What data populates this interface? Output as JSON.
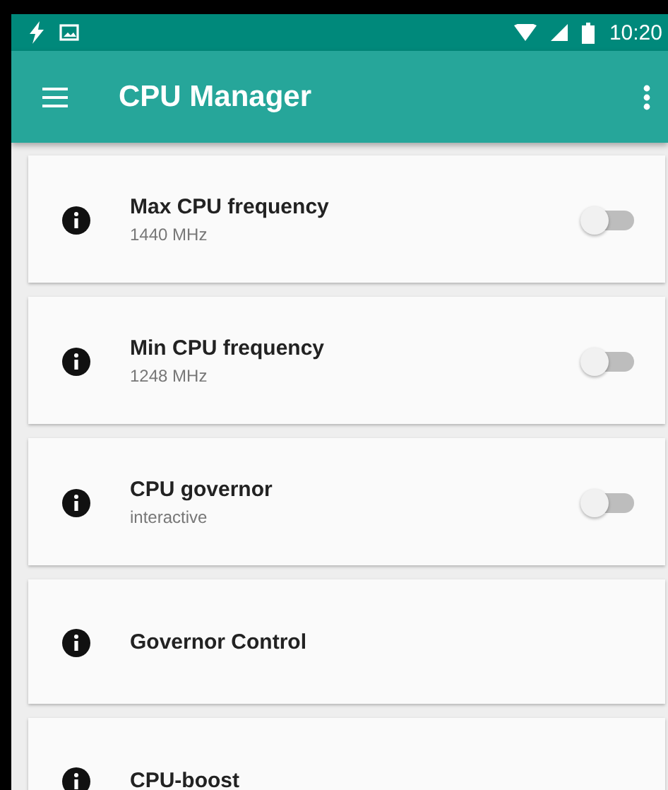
{
  "status_bar": {
    "time": "10:20"
  },
  "app_bar": {
    "title": "CPU Manager"
  },
  "items": [
    {
      "title": "Max CPU frequency",
      "subtitle": "1440 MHz",
      "toggle": {
        "on": false
      }
    },
    {
      "title": "Min CPU frequency",
      "subtitle": "1248 MHz",
      "toggle": {
        "on": false
      }
    },
    {
      "title": "CPU governor",
      "subtitle": "interactive",
      "toggle": {
        "on": false
      }
    },
    {
      "title": "Governor Control"
    },
    {
      "title": "CPU-boost"
    }
  ]
}
